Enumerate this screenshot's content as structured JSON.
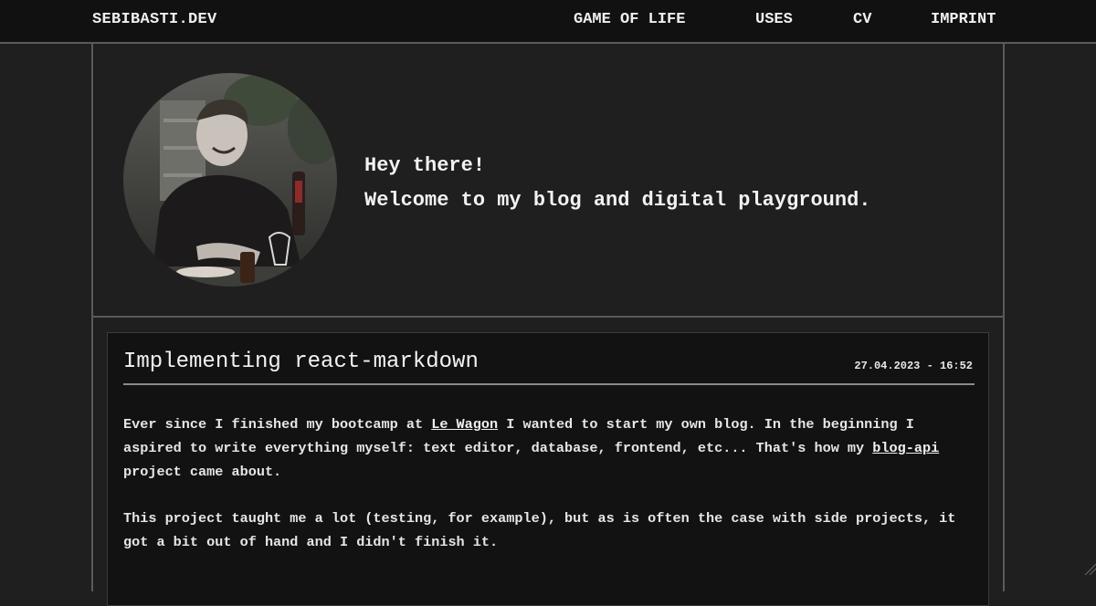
{
  "header": {
    "brand": "SEBIBASTI.DEV",
    "nav": [
      {
        "label": "GAME OF LIFE"
      },
      {
        "label": "USES"
      },
      {
        "label": "CV"
      },
      {
        "label": "IMPRINT"
      }
    ]
  },
  "hero": {
    "avatar_icon": "profile-photo",
    "line1": "Hey there!",
    "line2": "Welcome to my blog and digital playground."
  },
  "post": {
    "title": "Implementing react-markdown",
    "date": "27.04.2023 - 16:52",
    "p1": {
      "a": "Ever since I finished my bootcamp at ",
      "link1": "Le Wagon",
      "b": " I wanted to start my own blog. In the beginning I aspired to write everything myself: text editor, database, frontend, etc... That's how my ",
      "link2": "blog-api",
      "c": " project came about."
    },
    "p2": "This project taught me a lot (testing, for example), but as is often the case with side projects, it got a bit out of hand and I didn't finish it."
  },
  "colors": {
    "background": "#1f1f1f",
    "topbar": "#111111",
    "card": "#121212",
    "border": "#5a5a5a"
  }
}
